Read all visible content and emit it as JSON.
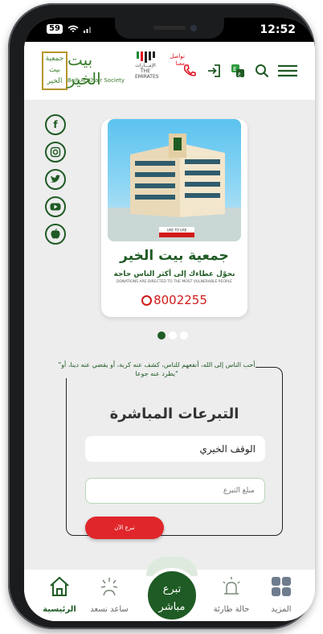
{
  "status_bar": {
    "battery": "59",
    "time": "12:52"
  },
  "header": {
    "logo_ar": "بيت الخير",
    "logo_en": "Beit Al Khair Society",
    "logo_badge": "جمعية بيت الخير",
    "emirates_caption_ar": "الإمـــارات",
    "emirates_caption_en": "THE EMIRATES",
    "call_text": "تواصل معنا",
    "icons": [
      "phone-icon",
      "login-icon",
      "language-icon",
      "search-icon",
      "menu-icon"
    ]
  },
  "social": [
    "facebook-icon",
    "instagram-icon",
    "twitter-icon",
    "youtube-icon",
    "apple-icon"
  ],
  "card": {
    "image_label": "UAE TO UAE",
    "title": "جمعية بيت الخير",
    "subtitle": "نحوّل عطاءك إلى أكثر الناس حاجة",
    "subtitle_en": "DONATIONS ARE DIRECTED TO THE MOST VULNERABLE PEOPLE",
    "phone": "8002255"
  },
  "carousel": {
    "count": 3,
    "active": 0
  },
  "donation": {
    "quote": "\"أحب الناس إلى الله، أنفعهم للناس، كشف عنه كربة، أو يقضي عنه دينا، أو يطرد عنه جوعا\"",
    "title": "التبرعات المباشرة",
    "category_value": "الوقف الخيري",
    "amount_placeholder": "مبلغ التبرع",
    "donate_button": "تبرع الآن"
  },
  "bottom_nav": {
    "home": "الرئيسية",
    "help": "ساعد نسعد",
    "donate_line1": "تبرع",
    "donate_line2": "مباشر",
    "emergency": "حالة طارئة",
    "more": "المزيد"
  },
  "colors": {
    "brand_green": "#1f5b24",
    "accent_red": "#e0262a",
    "gold": "#b4952a"
  }
}
